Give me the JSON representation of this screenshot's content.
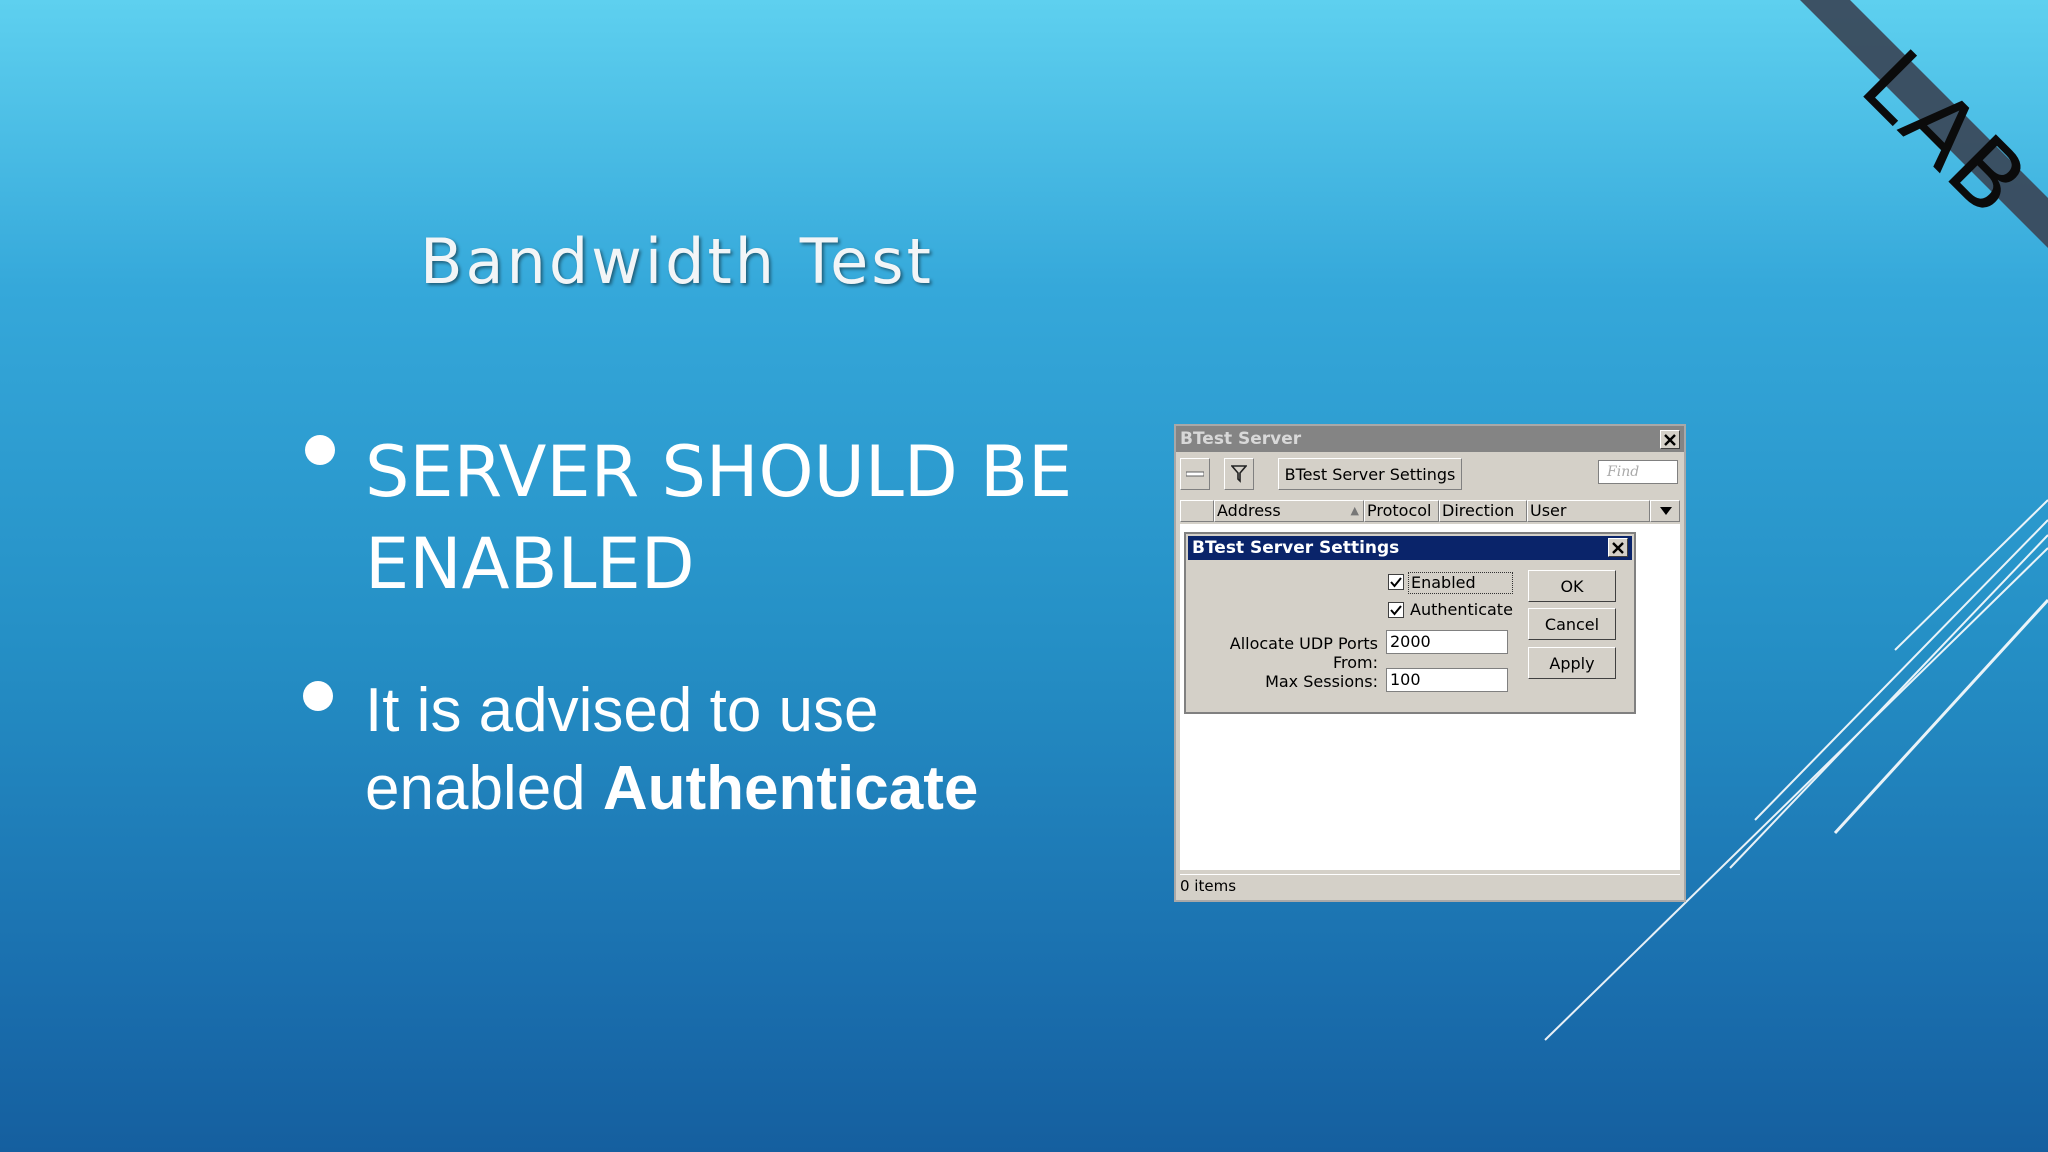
{
  "slide": {
    "title": "Bandwidth Test",
    "bullet1": "SERVER SHOULD BE ENABLED",
    "bullet2_plain": "It is advised to use enabled ",
    "bullet2_bold": "Authenticate",
    "corner_label": "LAB",
    "colors": {
      "background_top": "#5ed0ef",
      "background_bottom": "#155f9f",
      "corner_band": "#3a4a5c"
    }
  },
  "window": {
    "title": "BTest Server",
    "toolbar": {
      "settings_label": "BTest Server Settings",
      "find_placeholder": "Find"
    },
    "columns": [
      "Address",
      "Protocol",
      "Direction",
      "User"
    ],
    "status": "0 items"
  },
  "dialog": {
    "title": "BTest Server Settings",
    "enabled_label": "Enabled",
    "enabled_checked": true,
    "authenticate_label": "Authenticate",
    "authenticate_checked": true,
    "udp_ports_label": "Allocate UDP Ports From:",
    "udp_ports_value": "2000",
    "max_sessions_label": "Max Sessions:",
    "max_sessions_value": "100",
    "ok_label": "OK",
    "cancel_label": "Cancel",
    "apply_label": "Apply"
  }
}
